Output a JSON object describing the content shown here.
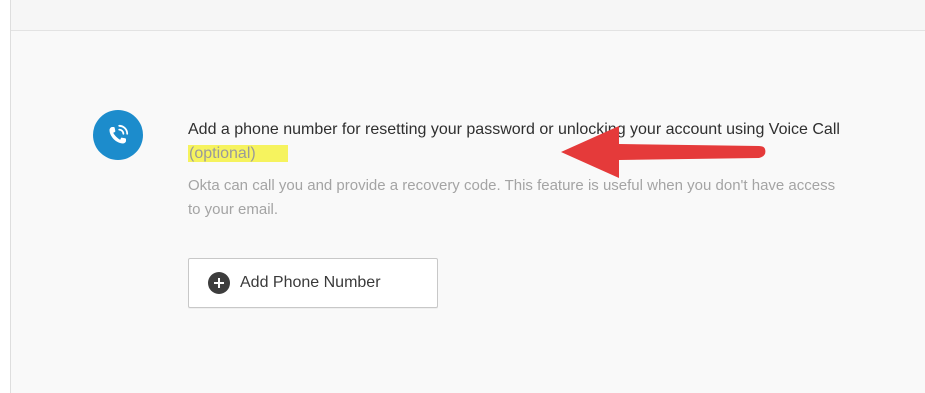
{
  "phone_section": {
    "icon": "phone-voice-icon",
    "title_main": "Add a phone number for resetting your password or unlocking your account using Voice Call",
    "title_optional": "(optional)",
    "description": "Okta can call you and provide a recovery code. This feature is useful when you don't have access to your email.",
    "add_button_icon": "plus-circle-icon",
    "add_button_label": "Add Phone Number"
  },
  "annotation": {
    "arrow_icon": "red-arrow-left-icon",
    "arrow_color": "#e53a3a",
    "highlight_color": "#f6f35e"
  },
  "colors": {
    "accent": "#1c8ccc"
  }
}
